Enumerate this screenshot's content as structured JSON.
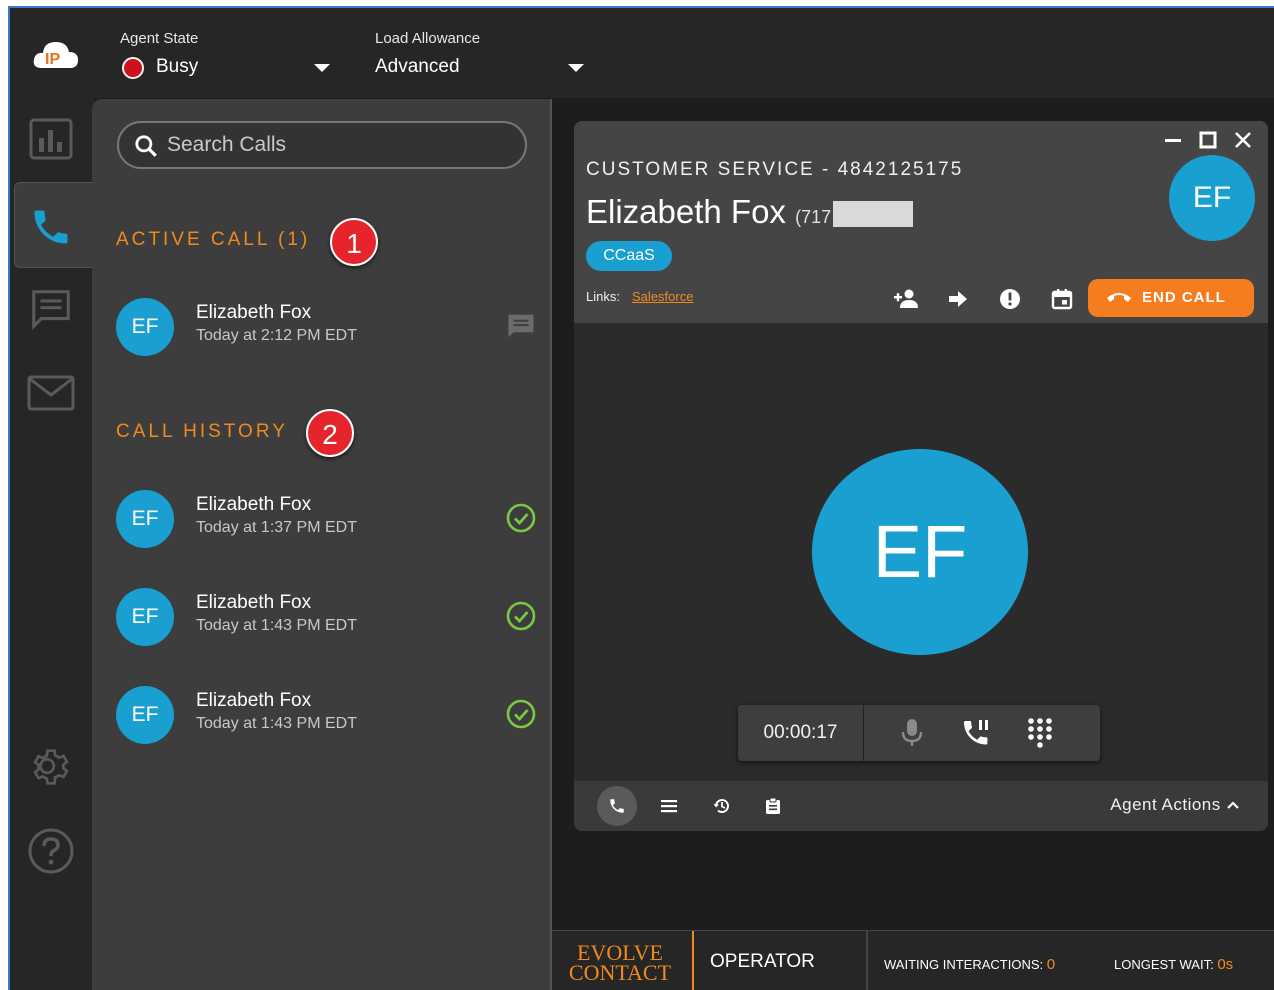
{
  "topbar": {
    "logo_text": "IP",
    "agent_state_label": "Agent State",
    "agent_state_value": "Busy",
    "load_allowance_label": "Load Allowance",
    "load_allowance_value": "Advanced"
  },
  "sidebar": {
    "items": [
      {
        "icon": "bar-chart-icon"
      },
      {
        "icon": "phone-icon",
        "active": true
      },
      {
        "icon": "chat-icon"
      },
      {
        "icon": "mail-icon"
      },
      {
        "icon": "gear-icon"
      },
      {
        "icon": "help-icon"
      }
    ]
  },
  "call_list": {
    "search_placeholder": "Search Calls",
    "active_title": "ACTIVE CALL (1)",
    "active_badge": "1",
    "active_calls": [
      {
        "initials": "EF",
        "name": "Elizabeth Fox",
        "time": "Today at 2:12 PM EDT",
        "status_icon": "chat-icon"
      }
    ],
    "history_title": "CALL HISTORY",
    "history_badge": "2",
    "history": [
      {
        "initials": "EF",
        "name": "Elizabeth Fox",
        "time": "Today at 1:37 PM EDT",
        "status_icon": "check-circle-icon"
      },
      {
        "initials": "EF",
        "name": "Elizabeth Fox",
        "time": "Today at 1:43 PM EDT",
        "status_icon": "check-circle-icon"
      },
      {
        "initials": "EF",
        "name": "Elizabeth Fox",
        "time": "Today at 1:43 PM EDT",
        "status_icon": "check-circle-icon"
      }
    ]
  },
  "call_card": {
    "queue": "CUSTOMER SERVICE - 4842125175",
    "caller_name": "Elizabeth Fox",
    "caller_phone_visible": "(717",
    "tag": "CCaaS",
    "links_label": "Links:",
    "links_value": "Salesforce",
    "initials": "EF",
    "end_call_label": "END CALL",
    "timer": "00:00:17",
    "agent_actions_label": "Agent Actions"
  },
  "statusbar": {
    "brand_line1": "EVOLVE",
    "brand_line2": "CONTACT",
    "mode": "OPERATOR",
    "waiting_label": "WAITING INTERACTIONS:",
    "waiting_value": "0",
    "longest_label": "LONGEST WAIT:",
    "longest_value": "0s"
  },
  "colors": {
    "accent_orange": "#f08a1f",
    "avatar_blue": "#1a9fd1",
    "busy_red": "#d0101a",
    "check_green": "#7ac943"
  }
}
